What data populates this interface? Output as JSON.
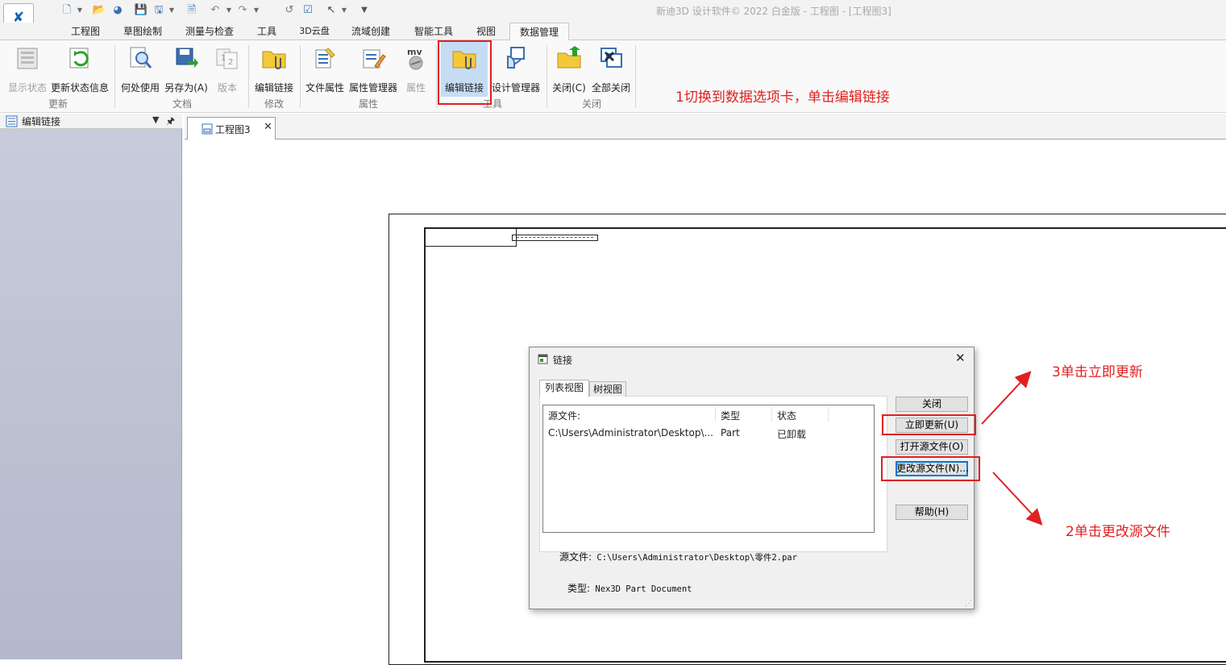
{
  "window": {
    "title": "新迪3D 设计软件© 2022 白金版 - 工程图 - [工程图3]"
  },
  "tabs": [
    {
      "label": "工程图",
      "active": false
    },
    {
      "label": "草图绘制",
      "active": false
    },
    {
      "label": "测量与检查",
      "active": false
    },
    {
      "label": "工具",
      "active": false
    },
    {
      "label": "3D云盘",
      "active": false
    },
    {
      "label": "流域创建",
      "active": false
    },
    {
      "label": "智能工具",
      "active": false
    },
    {
      "label": "视图",
      "active": false
    },
    {
      "label": "数据管理",
      "active": true
    }
  ],
  "ribbon": {
    "buttons": {
      "show_state": "显示状态",
      "update_state_info": "更新状态信息",
      "where_used": "何处使用",
      "save_as": "另存为(A)",
      "version": "版本",
      "edit_links_modify": "编辑链接",
      "file_properties": "文件属性",
      "property_manager": "属性管理器",
      "properties": "属性",
      "edit_links_tools": "编辑链接",
      "design_manager": "设计管理器",
      "close": "关闭(C)",
      "close_all": "全部关闭"
    },
    "groups": {
      "update": "更新",
      "document": "文档",
      "modify": "修改",
      "properties": "属性",
      "tools": "工具",
      "close": "关闭"
    }
  },
  "left_pane": {
    "title": "编辑链接"
  },
  "document_tab": {
    "label": "工程图3"
  },
  "dialog": {
    "title": "链接",
    "tabs": {
      "list_view": "列表视图",
      "tree_view": "树视图"
    },
    "columns": {
      "source": "源文件:",
      "type": "类型",
      "status": "状态"
    },
    "rows": [
      {
        "source": "C:\\Users\\Administrator\\Desktop\\...",
        "type": "Part",
        "status": "已卸载"
      }
    ],
    "buttons": {
      "close": "关闭",
      "update_now": "立即更新(U)",
      "open_source": "打开源文件(O)",
      "change_source": "更改源文件(N)...",
      "help": "帮助(H)"
    },
    "info": {
      "source_label": "源文件:",
      "source_value": "C:\\Users\\Administrator\\Desktop\\零件2.par",
      "type_label": "类型:",
      "type_value": "Nex3D Part Document"
    }
  },
  "annotations": {
    "step1": "1切换到数据选项卡，单击编辑链接",
    "step2": "2单击更改源文件",
    "step3": "3单击立即更新"
  },
  "colors": {
    "accent_blue": "#1463b8",
    "annotation_red": "#e02020",
    "selected_button_bg": "#c6dcf5"
  }
}
